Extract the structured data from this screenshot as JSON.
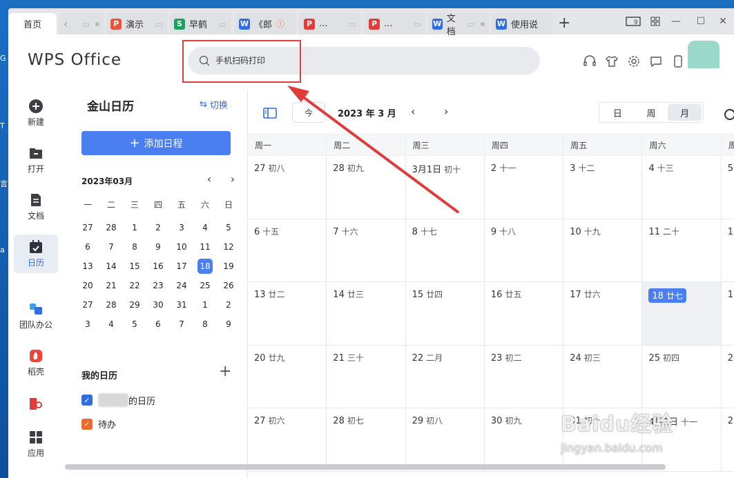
{
  "tabs": [
    {
      "label": "首页",
      "active": true
    },
    {
      "label": "",
      "icon": "back-icon"
    },
    {
      "label": "演示",
      "icon_letter": "P",
      "icon_color": "#e9543a"
    },
    {
      "label": "早鹤",
      "icon_letter": "S",
      "icon_color": "#1aa35c"
    },
    {
      "label": "《郎",
      "icon_letter": "W",
      "icon_color": "#2f6de0"
    },
    {
      "label": "...",
      "icon_letter": "P",
      "icon_color": "#e23b3b"
    },
    {
      "label": "...",
      "icon_letter": "P",
      "icon_color": "#e23b3b"
    },
    {
      "label": "文档",
      "icon_letter": "W",
      "icon_color": "#2f6de0"
    },
    {
      "label": "使用说",
      "icon_letter": "W",
      "icon_color": "#2f6de0"
    }
  ],
  "logo": "WPS Office",
  "search": {
    "placeholder": "手机扫码打印"
  },
  "nav": [
    {
      "label": "新建",
      "icon": "plus-circle-icon"
    },
    {
      "label": "打开",
      "icon": "folder-icon"
    },
    {
      "label": "文档",
      "icon": "document-icon"
    },
    {
      "label": "日历",
      "icon": "calendar-icon",
      "active": true
    },
    {
      "label": "团队办公",
      "icon": "team-icon"
    },
    {
      "label": "稻壳",
      "icon": "docer-icon"
    },
    {
      "label": "文库",
      "icon": "library-icon"
    },
    {
      "label": "应用",
      "icon": "apps-icon"
    }
  ],
  "sidebar": {
    "title": "金山日历",
    "switch_label": "切换",
    "add_label": "添加日程",
    "mini_month": "2023年03月",
    "weekdays": [
      "一",
      "二",
      "三",
      "四",
      "五",
      "六",
      "日"
    ],
    "days": [
      [
        "27",
        "28",
        "1",
        "2",
        "3",
        "4",
        "5"
      ],
      [
        "6",
        "7",
        "8",
        "9",
        "10",
        "11",
        "12"
      ],
      [
        "13",
        "14",
        "15",
        "16",
        "17",
        "18",
        "19"
      ],
      [
        "20",
        "21",
        "22",
        "23",
        "24",
        "25",
        "26"
      ],
      [
        "27",
        "28",
        "29",
        "30",
        "31",
        "1",
        "2"
      ],
      [
        "3",
        "4",
        "5",
        "6",
        "7",
        "8",
        "9"
      ]
    ],
    "today": "18",
    "my_calendars_title": "我的日历",
    "calendars": [
      {
        "label": "的日历",
        "color": "#2f6de0"
      },
      {
        "label": "待办",
        "color": "#ee6a2c"
      }
    ]
  },
  "main": {
    "today_label": "今",
    "month_label": "2023 年 3 月",
    "views": [
      "日",
      "周",
      "月"
    ],
    "active_view": "月",
    "week_headers": [
      "周一",
      "周二",
      "周三",
      "周四",
      "周五",
      "周六",
      "周日"
    ],
    "weeks": [
      [
        {
          "d": "27",
          "l": "初八"
        },
        {
          "d": "28",
          "l": "初九"
        },
        {
          "d": "3月1日",
          "l": "初十"
        },
        {
          "d": "2",
          "l": "十一"
        },
        {
          "d": "3",
          "l": "十二"
        },
        {
          "d": "4",
          "l": "十三"
        },
        {
          "d": "5",
          "l": "十四"
        }
      ],
      [
        {
          "d": "6",
          "l": "十五"
        },
        {
          "d": "7",
          "l": "十六"
        },
        {
          "d": "8",
          "l": "十七"
        },
        {
          "d": "9",
          "l": "十八"
        },
        {
          "d": "10",
          "l": "十九"
        },
        {
          "d": "11",
          "l": "二十"
        },
        {
          "d": "12",
          "l": "廿一"
        }
      ],
      [
        {
          "d": "13",
          "l": "廿二"
        },
        {
          "d": "14",
          "l": "廿三"
        },
        {
          "d": "15",
          "l": "廿四"
        },
        {
          "d": "16",
          "l": "廿五"
        },
        {
          "d": "17",
          "l": "廿六"
        },
        {
          "d": "18",
          "l": "廿七"
        },
        {
          "d": "19",
          "l": "廿八"
        }
      ],
      [
        {
          "d": "20",
          "l": "廿九"
        },
        {
          "d": "21",
          "l": "三十"
        },
        {
          "d": "22",
          "l": "二月"
        },
        {
          "d": "23",
          "l": "初二"
        },
        {
          "d": "24",
          "l": "初三"
        },
        {
          "d": "25",
          "l": "初四"
        },
        {
          "d": "26",
          "l": "初五"
        }
      ],
      [
        {
          "d": "27",
          "l": "初六"
        },
        {
          "d": "28",
          "l": "初七"
        },
        {
          "d": "29",
          "l": "初八"
        },
        {
          "d": "30",
          "l": "初九"
        },
        {
          "d": "31",
          "l": "初十"
        },
        {
          "d": "4月1日",
          "l": "十一"
        },
        {
          "d": "2",
          "l": "十二"
        }
      ]
    ],
    "today_index": [
      2,
      5
    ]
  },
  "watermark": {
    "title": "Baidu经验",
    "url": "jingyan.baidu.com"
  },
  "colors": {
    "accent": "#4b7ef0",
    "annotation": "#e23b3b"
  }
}
